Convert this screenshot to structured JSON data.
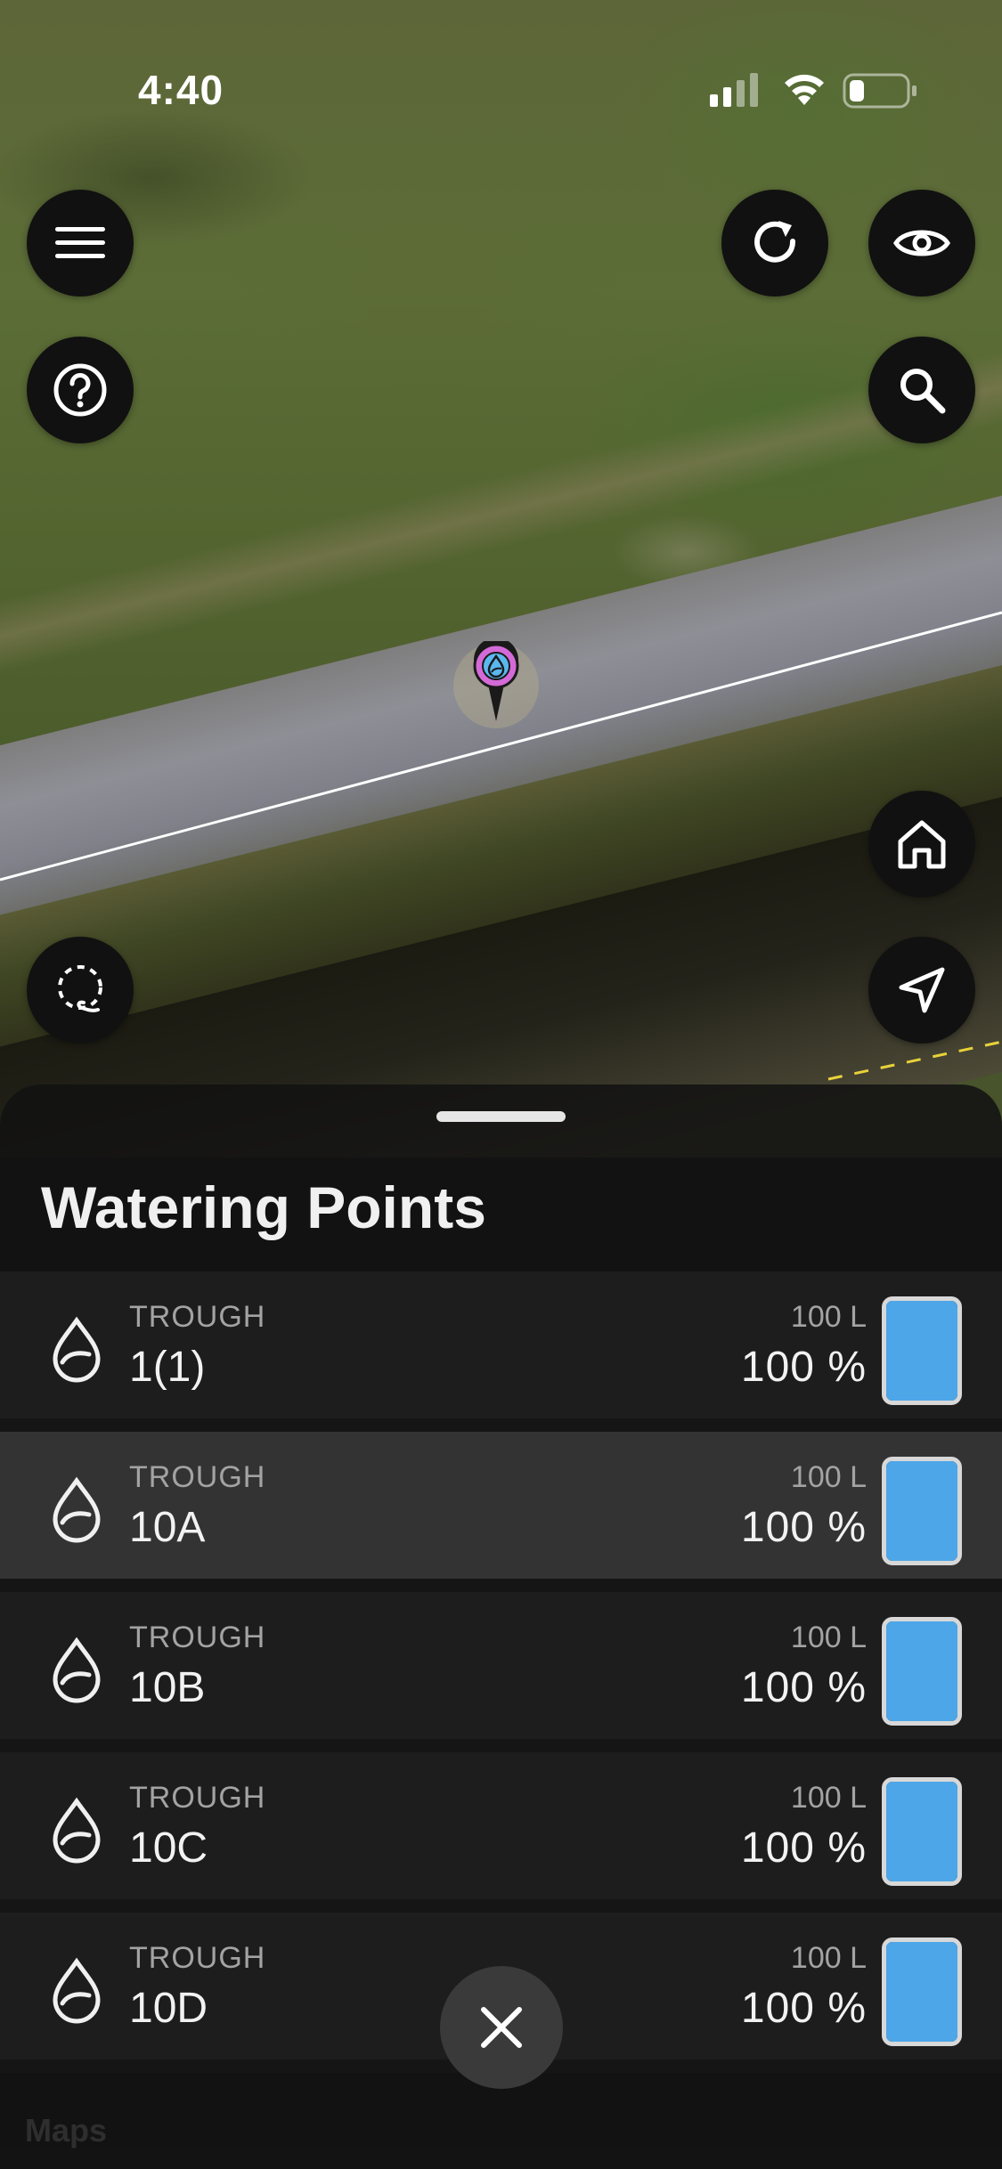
{
  "status_bar": {
    "time": "4:40"
  },
  "map": {
    "attribution": "Maps",
    "marker_color": "#d46ad8",
    "boundary_color": "#ffffff"
  },
  "map_controls": {
    "menu": "menu-icon",
    "help": "help-icon",
    "refresh": "refresh-icon",
    "visibility": "eye-icon",
    "search": "search-icon",
    "home": "home-icon",
    "lasso": "lasso-icon",
    "locate": "navigation-arrow-icon"
  },
  "sheet": {
    "title": "Watering Points",
    "close": "close-icon"
  },
  "watering_points": [
    {
      "type": "TROUGH",
      "name": "1(1)",
      "capacity": "100 L",
      "level": "100 %",
      "fill": 1.0,
      "selected": false
    },
    {
      "type": "TROUGH",
      "name": "10A",
      "capacity": "100 L",
      "level": "100 %",
      "fill": 1.0,
      "selected": true
    },
    {
      "type": "TROUGH",
      "name": "10B",
      "capacity": "100 L",
      "level": "100 %",
      "fill": 1.0,
      "selected": false
    },
    {
      "type": "TROUGH",
      "name": "10C",
      "capacity": "100 L",
      "level": "100 %",
      "fill": 1.0,
      "selected": false
    },
    {
      "type": "TROUGH",
      "name": "10D",
      "capacity": "100 L",
      "level": "100 %",
      "fill": 1.0,
      "selected": false
    }
  ],
  "colors": {
    "tank_fill": "#4da6e8",
    "sheet_bg": "#121212"
  }
}
